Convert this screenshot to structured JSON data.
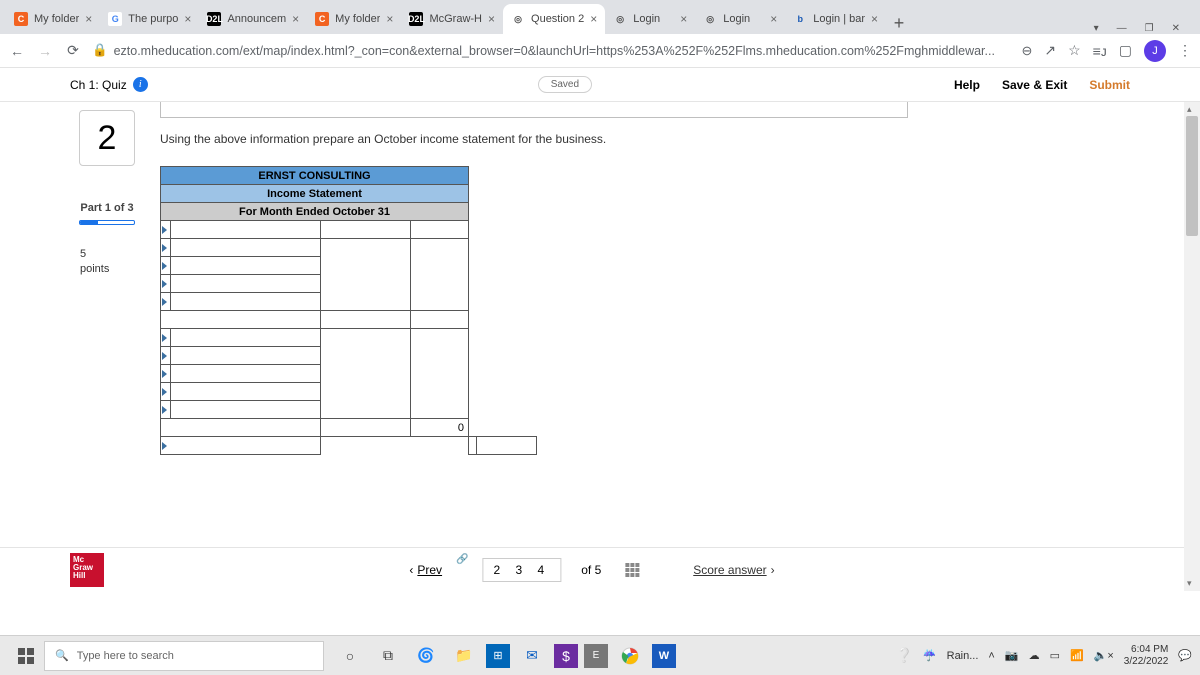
{
  "tabs": [
    {
      "fav": "C",
      "favbg": "#f26321",
      "favfg": "#fff",
      "title": "My folder"
    },
    {
      "fav": "G",
      "favbg": "#fff",
      "favfg": "#4285f4",
      "title": "The purpo"
    },
    {
      "fav": "D2L",
      "favbg": "#000",
      "favfg": "#fff",
      "title": "Announcem"
    },
    {
      "fav": "C",
      "favbg": "#f26321",
      "favfg": "#fff",
      "title": "My folder"
    },
    {
      "fav": "D2L",
      "favbg": "#000",
      "favfg": "#fff",
      "title": "McGraw-H"
    },
    {
      "fav": "◎",
      "favbg": "transparent",
      "favfg": "#555",
      "title": "Question 2"
    },
    {
      "fav": "◎",
      "favbg": "transparent",
      "favfg": "#555",
      "title": "Login"
    },
    {
      "fav": "◎",
      "favbg": "transparent",
      "favfg": "#555",
      "title": "Login"
    },
    {
      "fav": "b",
      "favbg": "transparent",
      "favfg": "#1a5ab5",
      "title": "Login | bar"
    }
  ],
  "active_tab_index": 5,
  "url": "ezto.mheducation.com/ext/map/index.html?_con=con&external_browser=0&launchUrl=https%253A%252F%252Flms.mheducation.com%252Fmghmiddlewar...",
  "avatar_letter": "J",
  "quiz": {
    "chapter": "Ch 1: Quiz",
    "saved": "Saved",
    "help": "Help",
    "save_exit": "Save & Exit",
    "submit": "Submit",
    "qnum": "2",
    "part": "Part 1 of 3",
    "points_value": "5",
    "points_label": "points",
    "instruction": "Using the above information prepare an October income statement for the business.",
    "table": {
      "h1": "ERNST CONSULTING",
      "h2": "Income Statement",
      "h3": "For Month Ended October 31",
      "zero": "0"
    },
    "nav": {
      "prev": "Prev",
      "pages": "2   3   4",
      "of": "of  5",
      "score": "Score answer"
    },
    "logo": {
      "l1": "Mc",
      "l2": "Graw",
      "l3": "Hill"
    }
  },
  "taskbar": {
    "search_placeholder": "Type here to search",
    "weather": "Rain...",
    "time": "6:04 PM",
    "date": "3/22/2022"
  }
}
